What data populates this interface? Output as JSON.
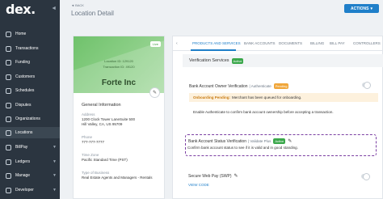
{
  "sidebar": {
    "logo": "dex.",
    "items": [
      {
        "label": "Home"
      },
      {
        "label": "Transactions"
      },
      {
        "label": "Funding"
      },
      {
        "label": "Customers"
      },
      {
        "label": "Schedules"
      },
      {
        "label": "Disputes"
      },
      {
        "label": "Organizations"
      },
      {
        "label": "Locations"
      },
      {
        "label": "BillPay"
      },
      {
        "label": "Ledgers"
      },
      {
        "label": "Manage"
      },
      {
        "label": "Developer"
      }
    ]
  },
  "header": {
    "back": "◄ BACK",
    "title": "Location Detail",
    "actions": "ACTIONS"
  },
  "location_card": {
    "status": "Live",
    "location_id": "Location ID: 129120",
    "transaction_id": "Transaction ID: 49120",
    "name": "Forte Inc",
    "general_info_title": "General Information",
    "address_label": "Address",
    "address_line1": "1200 Clock Tower LaneSuite 500",
    "address_line2": "Hill Valley, CA, US 95709",
    "phone_label": "Phone",
    "phone": "777-777-7777",
    "timezone_label": "Time Zone",
    "timezone": "Pacific Standard Time (PST)",
    "business_label": "Type of Business",
    "business_type": "Real Estate Agents and Managers - Rentals"
  },
  "tabs": [
    "PRODUCTS AND SERVICES",
    "BANK ACCOUNTS",
    "DOCUMENTS",
    "BILLING",
    "BILL PAY",
    "CONTROLLERS"
  ],
  "verification": {
    "title": "Verification Services",
    "status": "Active",
    "owner_title": "Bank Account Owner Verification",
    "owner_sub": "| Authenticate",
    "owner_status": "Pending",
    "onboard_strong": "Onboarding Pending:",
    "onboard_msg": "Merchant has been queued for onboarding.",
    "enable_text": "Enable Authenticate to confirm bank account ownership before accepting a transaction.",
    "status_title": "Bank Account Status Verification",
    "status_sub": "| Validate Plus",
    "status_badge": "Active",
    "status_desc": "Confirm bank account status to see if it is valid and in good standing."
  },
  "swp": {
    "title": "Secure Web Pay (SWP)",
    "view_code": "VIEW CODE"
  },
  "colors": {
    "sidebar": "#2b3540",
    "accent": "#1f7fc9",
    "live_green": "#3aa74a",
    "pending_orange": "#f0a63a",
    "highlight_purple": "#7b3fa2"
  }
}
